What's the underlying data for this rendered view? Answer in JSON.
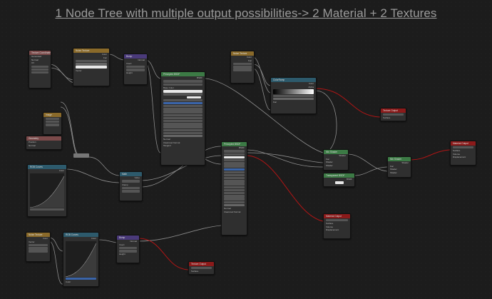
{
  "title": "1 Node Tree with multiple output possibilities-> 2 Material + 2 Textures",
  "nodes": {
    "texcoord_left": {
      "title": "Texture Coordinate",
      "rows": [
        "Generated",
        "Normal",
        "UV",
        "Object",
        "Camera",
        "Window",
        "Reflection"
      ]
    },
    "noise_left": {
      "title": "Noise Texture",
      "rows": [
        "Color",
        "Fac",
        "Vector",
        "Scale",
        "Detail",
        "Distortion"
      ]
    },
    "mapping_left": {
      "title": "Mapping",
      "rows": [
        "Vector",
        "Location",
        "Rotation",
        "Scale"
      ]
    },
    "bump_top": {
      "title": "Bump",
      "rows": [
        "Normal",
        "Invert",
        "Strength",
        "Distance",
        "Height",
        "Normal"
      ]
    },
    "principled_top": {
      "title": "Principled BSDF",
      "rows": [
        "BSDF",
        "GGX",
        "Christensen-Burley",
        "Base Color",
        "Subsurface",
        "Subsurface Radius",
        "Subsurface Color",
        "Metallic",
        "Specular",
        "Specular Tint",
        "Roughness",
        "Anisotropic",
        "Anisotropic Rotation",
        "Sheen",
        "Sheen Tint",
        "Clearcoat",
        "Clearcoat Roughness",
        "IOR",
        "Transmission",
        "Transmission Roughness",
        "Emission",
        "Alpha",
        "Normal",
        "Clearcoat Normal",
        "Tangent"
      ]
    },
    "noise_mid": {
      "title": "Noise Texture",
      "rows": [
        "Color",
        "Fac",
        "Vector",
        "Scale",
        "Detail",
        "Distortion"
      ]
    },
    "colorramp_right": {
      "title": "ColorRamp",
      "rows": [
        "Color",
        "Alpha",
        "Fac"
      ]
    },
    "texture_output_top": {
      "title": "Texture Output",
      "rows": [
        "Texture Name",
        "Surface"
      ]
    },
    "principled_mid": {
      "title": "Principled BSDF",
      "rows": [
        "BSDF",
        "GGX",
        "Christensen-Burley",
        "Base Color",
        "Subsurface",
        "Subsurface Radius",
        "Subsurface Color",
        "Metallic",
        "Specular",
        "Specular Tint",
        "Roughness",
        "Anisotropic",
        "Anisotropic Rotation",
        "Sheen",
        "Sheen Tint",
        "Clearcoat",
        "Clearcoat Roughness",
        "IOR",
        "Transmission",
        "Transmission Roughness",
        "Emission",
        "Alpha",
        "Normal",
        "Clearcoat Normal",
        "Tangent"
      ]
    },
    "mix_shader_1": {
      "title": "Mix Shader",
      "rows": [
        "Shader",
        "Fac",
        "Shader",
        "Shader"
      ]
    },
    "mix_shader_2": {
      "title": "Mix Shader",
      "rows": [
        "Shader",
        "Fac",
        "Shader",
        "Shader"
      ]
    },
    "material_output_right": {
      "title": "Material Output",
      "rows": [
        "All",
        "Surface",
        "Volume",
        "Displacement"
      ]
    },
    "transparent": {
      "title": "Transparent BSDF",
      "rows": [
        "BSDF",
        "Color"
      ]
    },
    "geometry": {
      "title": "Geometry",
      "rows": [
        "Position",
        "Normal",
        "Tangent",
        "True Normal",
        "Incoming",
        "Parametric",
        "Backfacing",
        "Pointiness"
      ]
    },
    "layer_weight": {
      "title": "Layer Weight",
      "rows": [
        "Fresnel",
        "Facing",
        "Blend",
        "Normal"
      ]
    },
    "math_node": {
      "title": "Math",
      "rows": [
        "Value",
        "Multiply",
        "Clamp",
        "Value",
        "Value"
      ]
    },
    "curves_left": {
      "title": "RGB Curves",
      "rows": [
        "Color",
        "Fac",
        "Color"
      ]
    },
    "material_output_mid": {
      "title": "Material Output",
      "rows": [
        "All",
        "Surface",
        "Volume",
        "Displacement"
      ]
    },
    "texcoord_bottom": {
      "title": "Noise Texture",
      "rows": [
        "Color",
        "Fac",
        "Vector",
        "Scale",
        "Detail",
        "Distortion"
      ]
    },
    "curves_bottom": {
      "title": "RGB Curves",
      "rows": [
        "Color",
        "Fac",
        "Color"
      ]
    },
    "bump_bottom": {
      "title": "Bump",
      "rows": [
        "Normal",
        "Invert",
        "Strength",
        "Distance",
        "Height",
        "Normal"
      ]
    },
    "texture_output_bottom": {
      "title": "Texture Output",
      "rows": [
        "Texture Name",
        "Surface"
      ]
    }
  },
  "colors": {
    "background": "#1c1c1c",
    "wire": "#9a9a9a",
    "wire_red": "#c01818",
    "output_header": "#8b1a1a"
  }
}
